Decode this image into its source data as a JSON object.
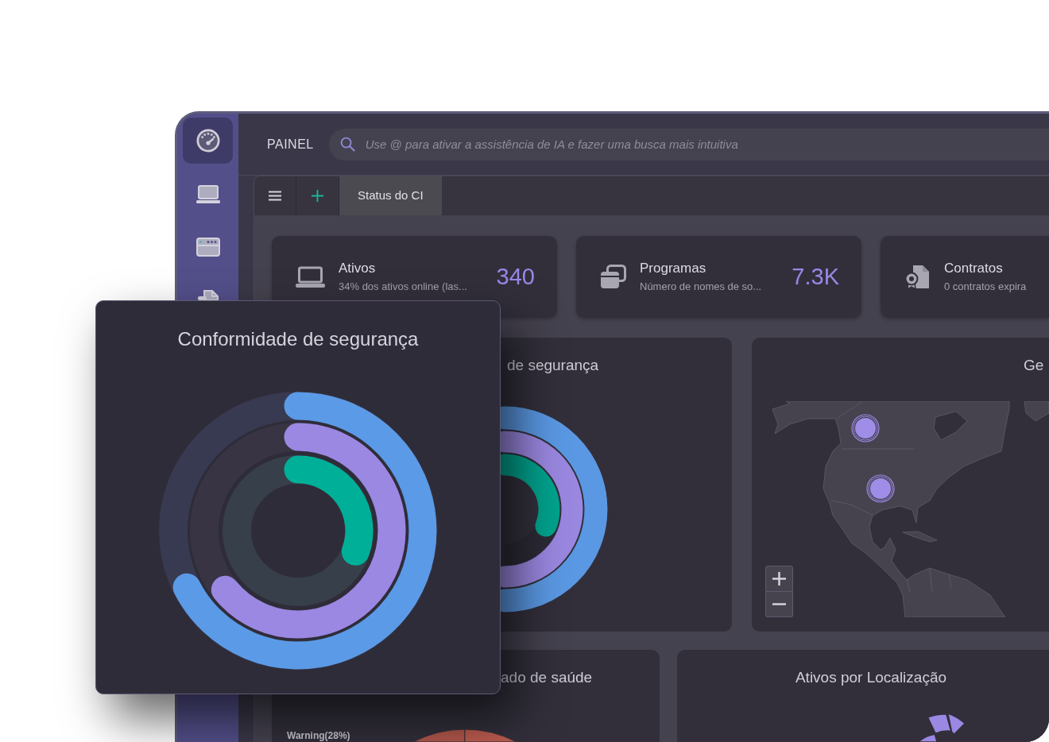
{
  "sidebar": {
    "items": [
      {
        "selected": true
      },
      {
        "selected": false
      },
      {
        "selected": false
      },
      {
        "selected": false
      }
    ]
  },
  "header": {
    "title": "PAINEL",
    "search": {
      "placeholder": "Use @ para ativar a assistência de IA e fazer uma busca mais intuitiva"
    }
  },
  "tabs": [
    {
      "label": "Status do CI",
      "selected": true
    }
  ],
  "kpis": [
    {
      "title": "Ativos",
      "subtitle": "34% dos ativos online (las...",
      "value": "340"
    },
    {
      "title": "Programas",
      "subtitle": "Número de nomes de so...",
      "value": "7.3K"
    },
    {
      "title": "Contratos",
      "subtitle": "0 contratos expira"
    }
  ],
  "panels": [
    {
      "kind": "radial",
      "title": "de segurança"
    },
    {
      "kind": "map",
      "title": "Ge"
    },
    {
      "kind": "pie",
      "title": "ado de saúde",
      "legend_label": "Warning(28%)"
    },
    {
      "kind": "polar",
      "title": "Ativos por Localização"
    }
  ],
  "overlay_card": {
    "title": "Conformidade de segurança"
  }
}
